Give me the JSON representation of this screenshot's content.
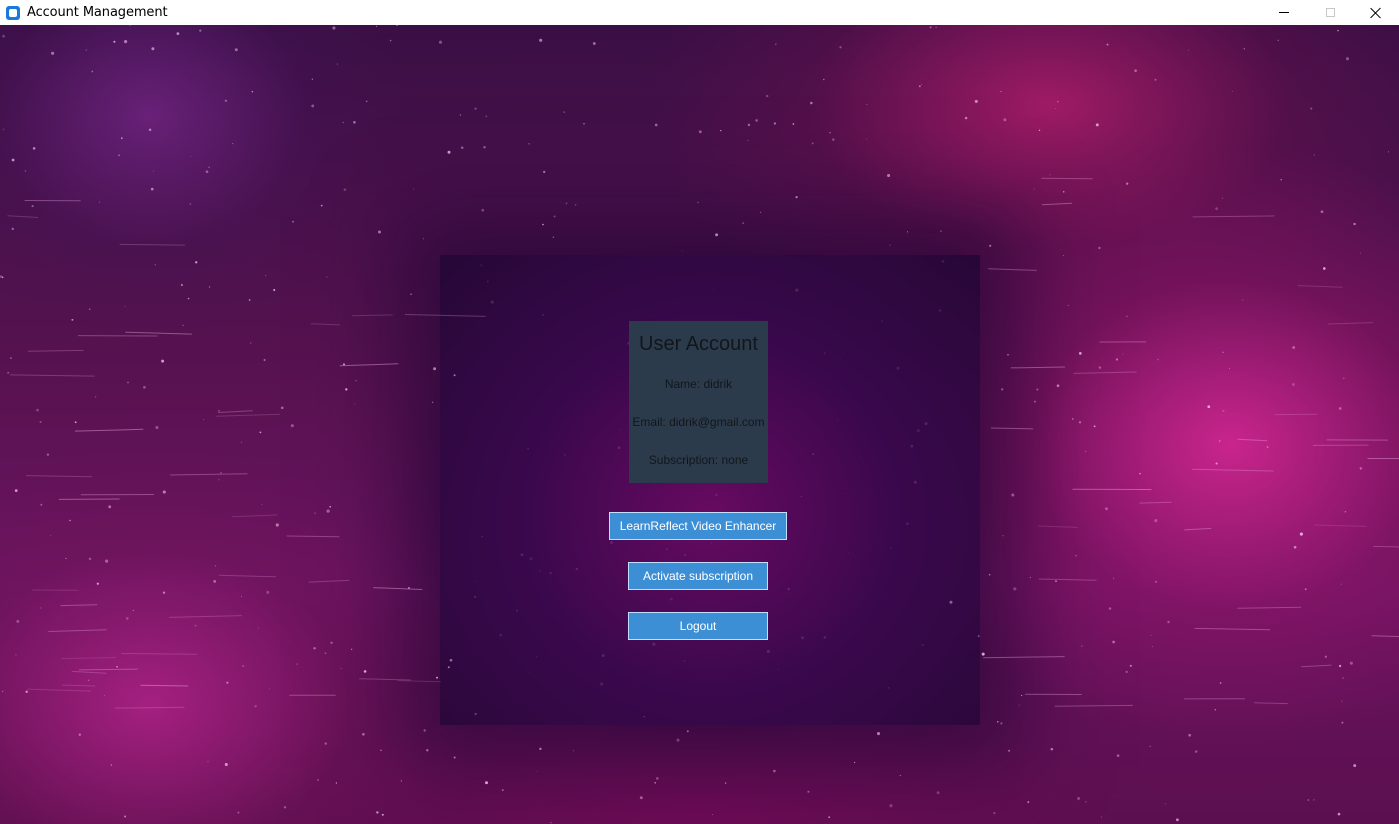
{
  "window": {
    "title": "Account Management",
    "controls": {
      "minimize": "minimize-icon",
      "maximize": "maximize-icon",
      "close": "close-icon"
    }
  },
  "account": {
    "title": "User Account",
    "name_line": "Name: didrik",
    "email_line": "Email: didrik@gmail.com",
    "subscription_line": "Subscription: none"
  },
  "buttons": {
    "enhancer": "LearnReflect Video Enhancer",
    "activate": "Activate subscription",
    "logout": "Logout"
  },
  "colors": {
    "card_bg": "#2b3b4c",
    "button_bg": "#3d8fd5",
    "text_dark": "#12161b"
  }
}
